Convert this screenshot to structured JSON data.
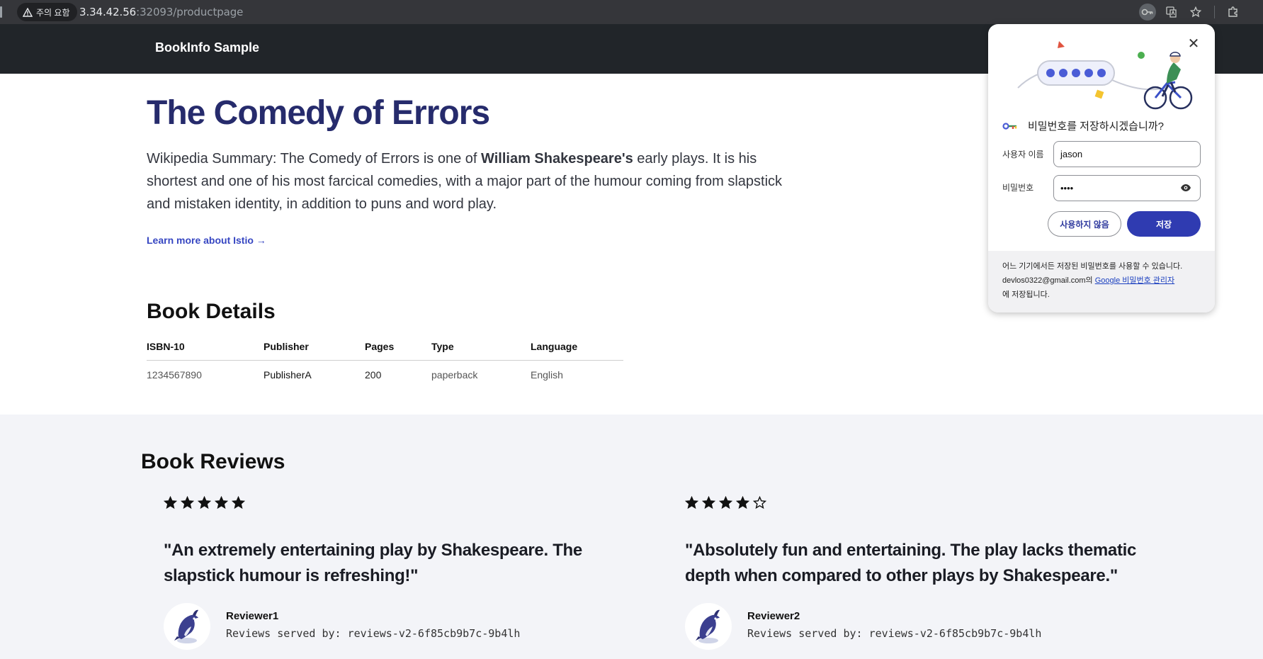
{
  "browser": {
    "security_chip": "주의 요함",
    "url_host": "3.34.42.56",
    "url_rest": ":32093/productpage"
  },
  "header": {
    "brand": "BookInfo Sample"
  },
  "intro": {
    "title": "The Comedy of Errors",
    "summary_before": "Wikipedia Summary: The Comedy of Errors is one of ",
    "summary_bold": "William Shakespeare's",
    "summary_after": " early plays. It is his shortest and one of his most farcical comedies, with a major part of the humour coming from slapstick and mistaken identity, in addition to puns and word play.",
    "learn_more": "Learn more about Istio →"
  },
  "details": {
    "title": "Book Details",
    "columns": [
      "ISBN-10",
      "Publisher",
      "Pages",
      "Type",
      "Language"
    ],
    "row": [
      "1234567890",
      "PublisherA",
      "200",
      "paperback",
      "English"
    ]
  },
  "reviews": {
    "title": "Book Reviews",
    "items": [
      {
        "stars": 5,
        "quote": "\"An extremely entertaining play by Shakespeare. The slapstick humour is refreshing!\"",
        "reviewer": "Reviewer1",
        "served_by": "Reviews served by: reviews-v2-6f85cb9b7c-9b4lh"
      },
      {
        "stars": 4,
        "quote": "\"Absolutely fun and entertaining. The play lacks thematic depth when compared to other plays by Shakespeare.\"",
        "reviewer": "Reviewer2",
        "served_by": "Reviews served by: reviews-v2-6f85cb9b7c-9b4lh"
      }
    ]
  },
  "password_popup": {
    "heading": "비밀번호를 저장하시겠습니까?",
    "username_label": "사용자 이름",
    "username_value": "jason",
    "password_label": "비밀번호",
    "password_value": "••••",
    "never_button": "사용하지 않음",
    "save_button": "저장",
    "footer_line1": "어느 기기에서든 저장된 비밀번호를 사용할 수 있습니다.",
    "footer_email": "devlos0322@gmail.com의 ",
    "footer_link": "Google 비밀번호 관리자",
    "footer_line3": "에 저장됩니다."
  },
  "colors": {
    "header_bg": "#212529",
    "title": "#262b6c",
    "link": "#3646c2",
    "reviews_bg": "#f3f4f8",
    "save_button": "#2f3bb1"
  }
}
